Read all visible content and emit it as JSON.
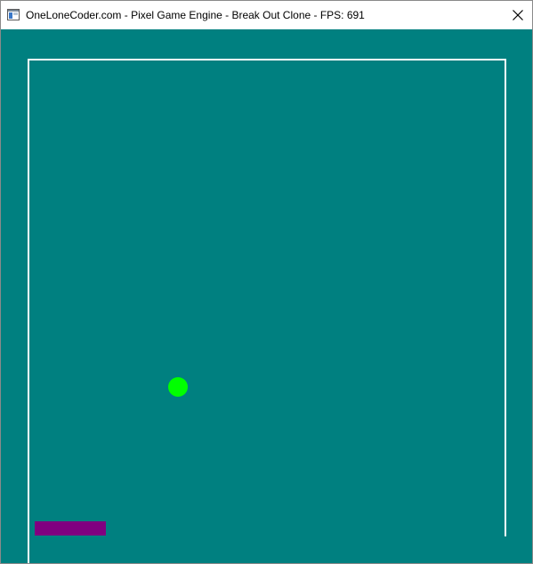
{
  "window": {
    "title": "OneLoneCoder.com - Pixel Game Engine - Break Out Clone - FPS: 691",
    "app_icon": "window-app-icon",
    "close_icon": "close-icon"
  },
  "game": {
    "background_color": "#008080",
    "wall_color": "#ffffff",
    "ball_color": "#00ff00",
    "bat_color": "#800080"
  }
}
